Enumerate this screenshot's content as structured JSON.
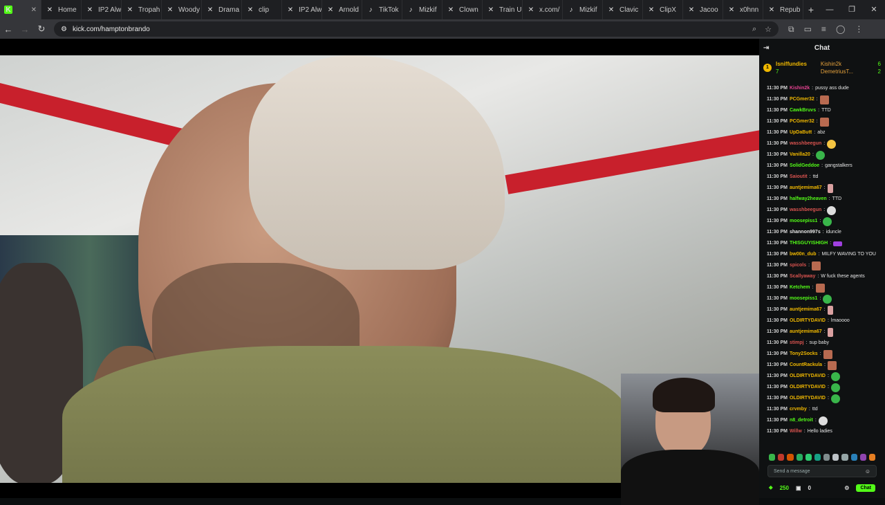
{
  "browser": {
    "tabs": [
      {
        "label": "",
        "icon": "kick-logo-icon",
        "active": true
      },
      {
        "label": "Home",
        "icon": "x-logo-icon"
      },
      {
        "label": "IP2 Alw",
        "icon": "x-logo-icon"
      },
      {
        "label": "Tropah",
        "icon": "x-logo-icon"
      },
      {
        "label": "Woody",
        "icon": "x-logo-icon"
      },
      {
        "label": "Drama",
        "icon": "x-logo-icon"
      },
      {
        "label": "clip",
        "icon": "x-logo-icon"
      },
      {
        "label": "IP2 Alw",
        "icon": "x-logo-icon"
      },
      {
        "label": "Arnold",
        "icon": "x-logo-icon"
      },
      {
        "label": "TikTok",
        "icon": "tiktok-icon"
      },
      {
        "label": "Mizkif",
        "icon": "tiktok-icon"
      },
      {
        "label": "Clown",
        "icon": "x-logo-icon"
      },
      {
        "label": "Train U",
        "icon": "x-logo-icon"
      },
      {
        "label": "x.com/",
        "icon": "x-logo-icon"
      },
      {
        "label": "Mizkif",
        "icon": "tiktok-icon"
      },
      {
        "label": "Clavic",
        "icon": "x-logo-icon"
      },
      {
        "label": "ClipX",
        "icon": "x-logo-icon"
      },
      {
        "label": "Jacoo",
        "icon": "x-logo-icon"
      },
      {
        "label": "x0hnn",
        "icon": "x-logo-icon"
      },
      {
        "label": "Repub",
        "icon": "x-logo-icon"
      }
    ],
    "url": "kick.com/hamptonbrando"
  },
  "chat": {
    "title": "Chat",
    "leaderboard": [
      {
        "name": "lsniffundies",
        "count": "7"
      },
      {
        "name": "Kishin2k",
        "count": "6"
      },
      {
        "name": "DemetriusT...",
        "count": "2"
      }
    ],
    "messages": [
      {
        "ts": "11:30 PM",
        "user": "Kishin2k",
        "color": "#e84393",
        "text": "pussy ass dude",
        "emote": ""
      },
      {
        "ts": "11:30 PM",
        "user": "PCGmer32",
        "color": "#f0b800",
        "text": "",
        "emote": "face"
      },
      {
        "ts": "11:30 PM",
        "user": "CawkBruvs",
        "color": "#53fc18",
        "text": "TTD",
        "emote": ""
      },
      {
        "ts": "11:30 PM",
        "user": "PCGmer32",
        "color": "#f0b800",
        "text": "",
        "emote": "face"
      },
      {
        "ts": "11:30 PM",
        "user": "UpDaButt",
        "color": "#f0b800",
        "text": "abz",
        "emote": ""
      },
      {
        "ts": "11:30 PM",
        "user": "wasshbeegun",
        "color": "#d9534f",
        "text": "",
        "emote": "yellow"
      },
      {
        "ts": "11:30 PM",
        "user": "Vanilla20",
        "color": "#f0b800",
        "text": "",
        "emote": "green"
      },
      {
        "ts": "11:30 PM",
        "user": "SolidGeddoe",
        "color": "#53fc18",
        "text": "gangstalkers",
        "emote": ""
      },
      {
        "ts": "11:30 PM",
        "user": "Saioutit",
        "color": "#d9534f",
        "text": "ttd",
        "emote": ""
      },
      {
        "ts": "11:30 PM",
        "user": "auntjemima67",
        "color": "#f0b800",
        "text": "",
        "emote": "pink"
      },
      {
        "ts": "11:30 PM",
        "user": "halfway2heaven",
        "color": "#53fc18",
        "text": "TTD",
        "emote": ""
      },
      {
        "ts": "11:30 PM",
        "user": "wasshbeegun",
        "color": "#d9534f",
        "text": "",
        "emote": "gray"
      },
      {
        "ts": "11:30 PM",
        "user": "moosepiss1",
        "color": "#53fc18",
        "text": "",
        "emote": "green"
      },
      {
        "ts": "11:30 PM",
        "user": "shannon997s",
        "color": "#e6e6e6",
        "text": "iduncle",
        "emote": ""
      },
      {
        "ts": "11:30 PM",
        "user": "THISGUYISHIGH",
        "color": "#53fc18",
        "text": "",
        "emote": "purple"
      },
      {
        "ts": "11:30 PM",
        "user": "bw00n_dub",
        "color": "#f0b800",
        "text": "MILFY WAVING TO YOU",
        "emote": ""
      },
      {
        "ts": "11:30 PM",
        "user": "spicols",
        "color": "#d9534f",
        "text": "",
        "emote": "face"
      },
      {
        "ts": "11:30 PM",
        "user": "Scallyaway",
        "color": "#d9534f",
        "text": "W fuck these agents",
        "emote": ""
      },
      {
        "ts": "11:30 PM",
        "user": "Ketchem",
        "color": "#53fc18",
        "text": "",
        "emote": "face"
      },
      {
        "ts": "11:30 PM",
        "user": "moosepiss1",
        "color": "#53fc18",
        "text": "",
        "emote": "green"
      },
      {
        "ts": "11:30 PM",
        "user": "auntjemima67",
        "color": "#f0b800",
        "text": "",
        "emote": "pink"
      },
      {
        "ts": "11:30 PM",
        "user": "OLDIRTYDAVID",
        "color": "#f0b800",
        "text": "lmaoooo",
        "emote": ""
      },
      {
        "ts": "11:30 PM",
        "user": "auntjemima67",
        "color": "#f0b800",
        "text": "",
        "emote": "pink"
      },
      {
        "ts": "11:30 PM",
        "user": "stimpj",
        "color": "#d9534f",
        "text": "sup baby",
        "emote": ""
      },
      {
        "ts": "11:30 PM",
        "user": "Tony2Socks",
        "color": "#f0b800",
        "text": "",
        "emote": "face"
      },
      {
        "ts": "11:30 PM",
        "user": "CountRackula",
        "color": "#f0b800",
        "text": "",
        "emote": "face"
      },
      {
        "ts": "11:30 PM",
        "user": "OLDIRTYDAVID",
        "color": "#f0b800",
        "text": "",
        "emote": "green"
      },
      {
        "ts": "11:30 PM",
        "user": "OLDIRTYDAVID",
        "color": "#f0b800",
        "text": "",
        "emote": "green"
      },
      {
        "ts": "11:30 PM",
        "user": "OLDIRTYDAVID",
        "color": "#f0b800",
        "text": "",
        "emote": "green"
      },
      {
        "ts": "11:30 PM",
        "user": "crvmby",
        "color": "#f0b800",
        "text": "ttd",
        "emote": ""
      },
      {
        "ts": "11:30 PM",
        "user": "n8_detroit",
        "color": "#53fc18",
        "text": "",
        "emote": "gray"
      },
      {
        "ts": "11:30 PM",
        "user": "Willw",
        "color": "#d9534f",
        "text": "Hello ladies",
        "emote": ""
      }
    ],
    "input_placeholder": "Send a message",
    "points": "250",
    "gifts": "0",
    "chat_button": "Chat"
  },
  "colors": {
    "kick_green": "#53fc18",
    "bg": "#0f1112"
  }
}
